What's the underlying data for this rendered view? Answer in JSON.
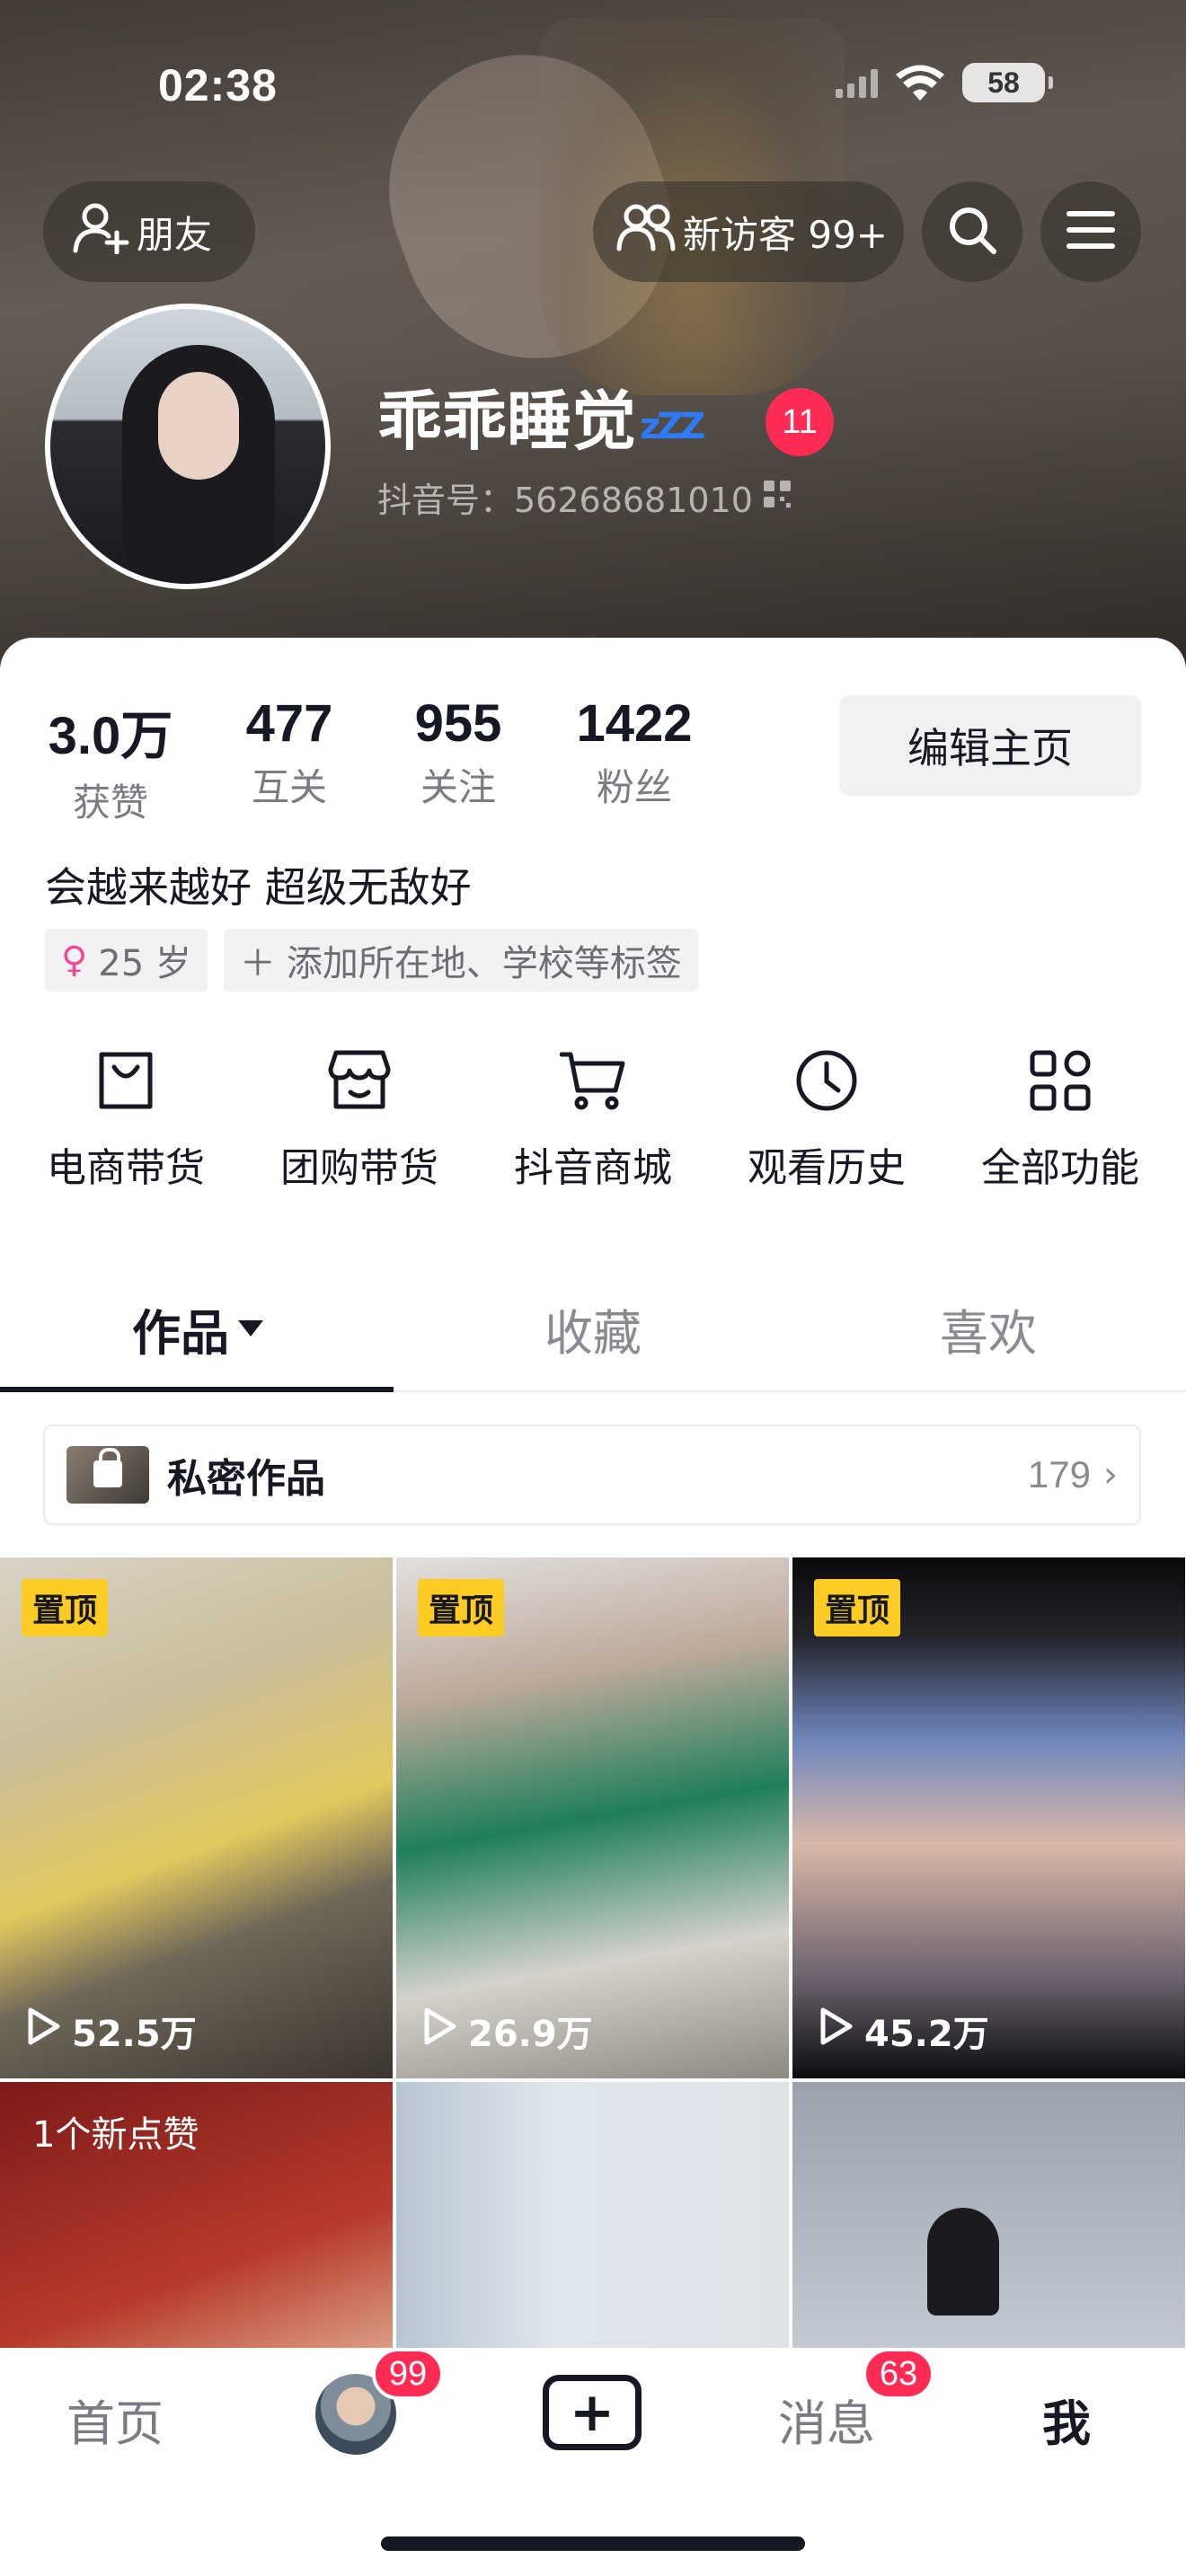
{
  "status_bar": {
    "time": "02:38",
    "battery": "58"
  },
  "header": {
    "friends_label": "朋友",
    "visitors_label": "新访客 99+",
    "username": "乖乖睡觉",
    "zzz": "zZZ",
    "name_badge": "11",
    "douyin_id": "抖音号：56268681010"
  },
  "stats": [
    {
      "value": "3.0万",
      "label": "获赞"
    },
    {
      "value": "477",
      "label": "互关"
    },
    {
      "value": "955",
      "label": "关注"
    },
    {
      "value": "1422",
      "label": "粉丝"
    }
  ],
  "edit_button": "编辑主页",
  "bio": "会越来越好 超级无敌好",
  "tags": {
    "age": "25 岁",
    "add": "添加所在地、学校等标签"
  },
  "functions": [
    {
      "label": "电商带货",
      "icon": "bag-icon"
    },
    {
      "label": "团购带货",
      "icon": "shop-icon"
    },
    {
      "label": "抖音商城",
      "icon": "cart-icon"
    },
    {
      "label": "观看历史",
      "icon": "clock-icon"
    },
    {
      "label": "全部功能",
      "icon": "grid-icon"
    }
  ],
  "tabs": [
    {
      "label": "作品",
      "active": true
    },
    {
      "label": "收藏",
      "active": false
    },
    {
      "label": "喜欢",
      "active": false
    }
  ],
  "private_works": {
    "label": "私密作品",
    "count": "179"
  },
  "videos": [
    {
      "pinned": "置顶",
      "views": "52.5万"
    },
    {
      "pinned": "置顶",
      "views": "26.9万"
    },
    {
      "pinned": "置顶",
      "views": "45.2万"
    },
    {
      "note": "1个新点赞"
    }
  ],
  "bottom_nav": {
    "home": "首页",
    "friend_badge": "99",
    "messages": "消息",
    "messages_badge": "63",
    "me": "我"
  },
  "colors": {
    "accent": "#fe2c55",
    "pin": "#fccc24",
    "text": "#161823"
  }
}
